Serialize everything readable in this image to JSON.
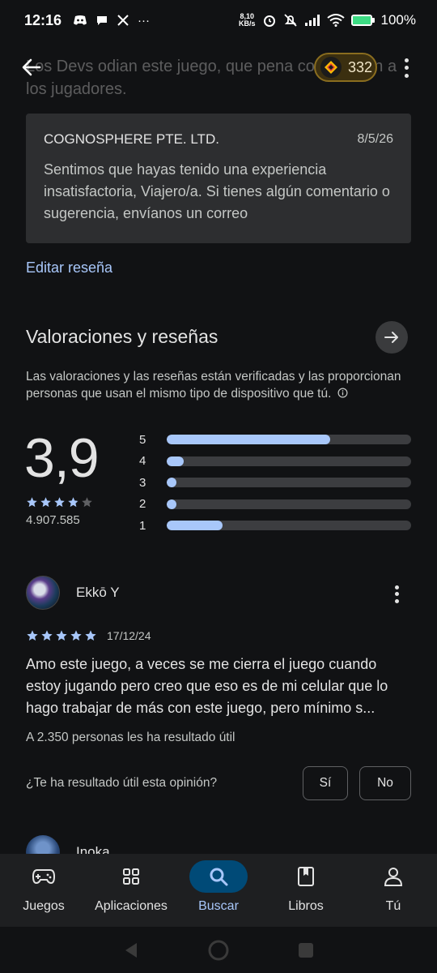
{
  "status_bar": {
    "time": "12:16",
    "net_speed_value": "8,10",
    "net_speed_unit": "KB/s",
    "battery": "100%",
    "battery_level": 1.0
  },
  "top_bar": {
    "ghost_text": "Los Devs odian este juego, que pena como tratan a los jugadores.",
    "points": "332"
  },
  "developer_reply": {
    "name": "COGNOSPHERE PTE. LTD.",
    "date": "8/5/26",
    "text": "Sentimos que hayas tenido una experiencia insatisfactoria, Viajero/a. Si tienes algún comentario o sugerencia, envíanos un correo"
  },
  "edit_review_label": "Editar reseña",
  "ratings": {
    "title": "Valoraciones y reseñas",
    "description": "Las valoraciones y las reseñas están verificadas y las proporcionan personas que usan el mismo tipo de dispositivo que tú.",
    "score": "3,9",
    "star_rating": 3.9,
    "total_reviews": "4.907.585",
    "histogram": [
      {
        "label": "5",
        "fraction": 0.67
      },
      {
        "label": "4",
        "fraction": 0.07
      },
      {
        "label": "3",
        "fraction": 0.04
      },
      {
        "label": "2",
        "fraction": 0.04
      },
      {
        "label": "1",
        "fraction": 0.23
      }
    ]
  },
  "review": {
    "author": "Ekkō Y",
    "stars": 5,
    "date": "17/12/24",
    "text": "Amo este juego, a veces se me cierra el juego cuando estoy jugando pero creo que eso es de mi celular que lo hago trabajar de más con este juego, pero mínimo s...",
    "helpful_count": "A 2.350 personas les ha resultado útil",
    "helpful_question": "¿Te ha resultado útil esta opinión?",
    "yes_label": "Sí",
    "no_label": "No"
  },
  "next_review": {
    "author": "Inoka"
  },
  "bottom_nav": [
    {
      "label": "Juegos",
      "icon": "gamepad-icon",
      "active": false
    },
    {
      "label": "Aplicaciones",
      "icon": "apps-grid-icon",
      "active": false
    },
    {
      "label": "Buscar",
      "icon": "search-icon",
      "active": true
    },
    {
      "label": "Libros",
      "icon": "book-icon",
      "active": false
    },
    {
      "label": "Tú",
      "icon": "person-icon",
      "active": false
    }
  ],
  "colors": {
    "background": "#111214",
    "accent": "#a8c7fa",
    "active_nav": "#004a77",
    "card": "#2d2e30"
  }
}
